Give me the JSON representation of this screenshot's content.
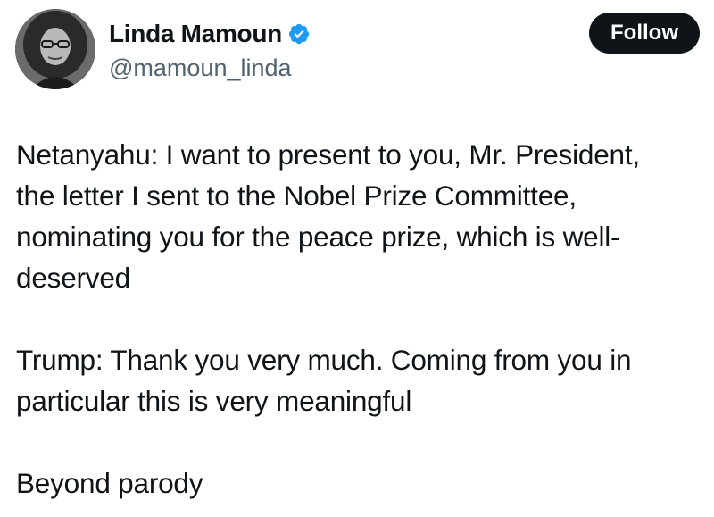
{
  "author": {
    "display_name": "Linda Mamoun",
    "handle": "@mamoun_linda",
    "verified": true,
    "avatar_icon": "profile-photo"
  },
  "actions": {
    "follow_label": "Follow"
  },
  "tweet": {
    "paragraphs": [
      {
        "lines": [
          "Netanyahu: I want to present to you, Mr. President,",
          "the letter I sent to the Nobel Prize Committee,",
          "nominating you for the peace prize, which is well-",
          "deserved"
        ]
      },
      {
        "lines": [
          "Trump: Thank you very much. Coming from you in",
          "particular this is very meaningful"
        ]
      },
      {
        "lines": [
          "Beyond parody"
        ]
      }
    ]
  },
  "colors": {
    "text": "#0f1419",
    "secondary_text": "#536471",
    "verified_badge": "#1d9bf0",
    "follow_button_bg": "#0f1419",
    "follow_button_text": "#ffffff"
  }
}
